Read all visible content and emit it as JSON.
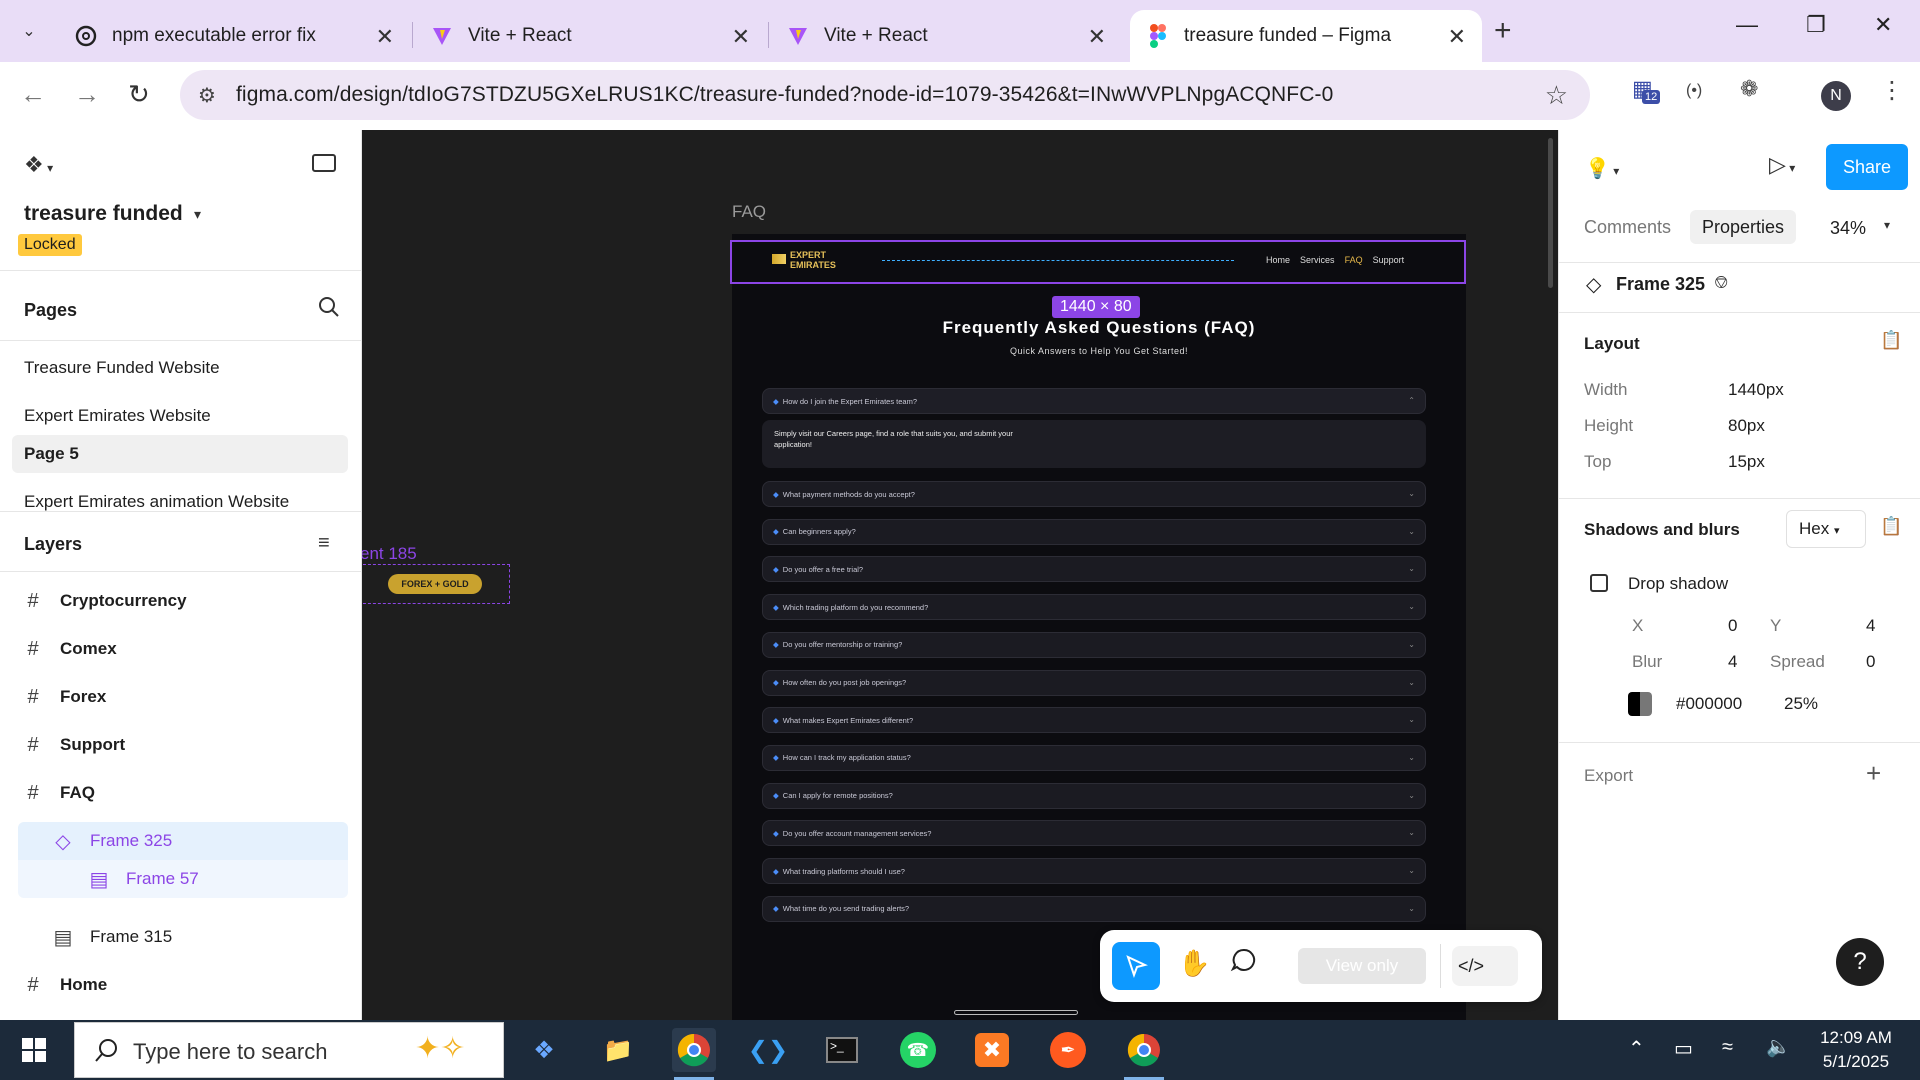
{
  "browser": {
    "tabs": [
      {
        "title": "npm executable error fix",
        "icon": "chatgpt-icon"
      },
      {
        "title": "Vite + React",
        "icon": "vite-icon"
      },
      {
        "title": "Vite + React",
        "icon": "vite-icon"
      },
      {
        "title": "treasure funded – Figma",
        "icon": "figma-icon"
      }
    ],
    "url": "figma.com/design/tdIoG7STDZU5GXeLRUS1KC/treasure-funded?node-id=1079-35426&t=INwWVPLNpgACQNFC-0",
    "extension_badge": "12",
    "profile_initial": "N"
  },
  "left_panel": {
    "file_name": "treasure funded",
    "locked_badge": "Locked",
    "pages_header": "Pages",
    "pages": [
      {
        "name": "Treasure Funded Website"
      },
      {
        "name": "Expert Emirates Website"
      },
      {
        "name": "Page 5"
      },
      {
        "name": "Expert Emirates animation Website"
      }
    ],
    "layers_header": "Layers",
    "layers": [
      {
        "name": "Cryptocurrency",
        "icon": "frame-hash-icon"
      },
      {
        "name": "Comex",
        "icon": "frame-hash-icon"
      },
      {
        "name": "Forex",
        "icon": "frame-hash-icon"
      },
      {
        "name": "Support",
        "icon": "frame-hash-icon"
      },
      {
        "name": "FAQ",
        "icon": "frame-hash-icon"
      },
      {
        "name": "Frame 325",
        "icon": "component-instance-icon"
      },
      {
        "name": "Frame 57",
        "icon": "auto-layout-icon"
      },
      {
        "name": "Frame 315",
        "icon": "auto-layout-icon"
      },
      {
        "name": "Home",
        "icon": "frame-hash-icon"
      }
    ]
  },
  "canvas": {
    "frame_label": "FAQ",
    "side_label": "ent 185",
    "side_pill": "FOREX + GOLD",
    "size_badge": "1440 × 80",
    "site": {
      "brand": "EXPERT\nEMIRATES",
      "brand_line1": "EXPERT",
      "brand_line2": "EMIRATES",
      "nav": [
        "Home",
        "Services",
        "FAQ",
        "Support"
      ],
      "title": "Frequently Asked Questions (FAQ)",
      "subtitle": "Quick Answers to Help You Get Started!",
      "open_question": "How do I join the Expert Emirates team?",
      "open_answer": "Simply visit our Careers page, find a role that suits you, and submit your application!",
      "questions": [
        "What payment methods do you accept?",
        "Can beginners apply?",
        "Do you offer a free trial?",
        "Which trading platform do you recommend?",
        "Do you offer mentorship or training?",
        "How often do you post job openings?",
        "What makes Expert Emirates different?",
        "How can I track my application status?",
        "Can I apply for remote positions?",
        "Do you offer account management services?",
        "What trading platforms should I use?",
        "What time do you send trading alerts?"
      ]
    },
    "toolbar": {
      "view_only": "View only"
    }
  },
  "right_panel": {
    "share": "Share",
    "tabs": [
      "Comments",
      "Properties"
    ],
    "zoom": "34%",
    "selection_name": "Frame 325",
    "layout_header": "Layout",
    "layout": [
      {
        "label": "Width",
        "value": "1440px"
      },
      {
        "label": "Height",
        "value": "80px"
      },
      {
        "label": "Top",
        "value": "15px"
      }
    ],
    "shadows_header": "Shadows and blurs",
    "color_format": "Hex",
    "drop_shadow": "Drop shadow",
    "shadow": {
      "x_label": "X",
      "x": "0",
      "y_label": "Y",
      "y": "4",
      "blur_label": "Blur",
      "blur": "4",
      "spread_label": "Spread",
      "spread": "0",
      "color": "#000000",
      "opacity": "25%"
    },
    "export_header": "Export"
  },
  "taskbar": {
    "search_placeholder": "Type here to search",
    "time": "12:09 AM",
    "date": "5/1/2025"
  },
  "colors": {
    "figma_accent": "#8c45e6",
    "share_blue": "#0d99ff",
    "canvas_bg": "#1e1e1e"
  }
}
